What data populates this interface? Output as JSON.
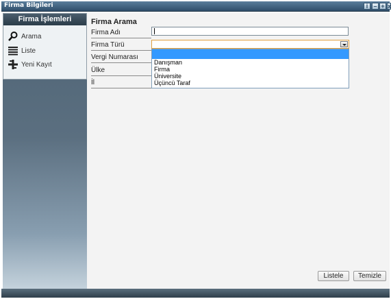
{
  "window": {
    "title": "Firma Bilgileri"
  },
  "sidebar": {
    "header": "Firma İşlemleri",
    "items": [
      {
        "label": "Arama",
        "icon": "search-icon"
      },
      {
        "label": "Liste",
        "icon": "list-icon"
      },
      {
        "label": "Yeni Kayıt",
        "icon": "new-record-icon"
      }
    ]
  },
  "main": {
    "title": "Firma Arama",
    "fields": {
      "firma_adi": {
        "label": "Firma Adı",
        "value": ""
      },
      "firma_turu": {
        "label": "Firma Türü",
        "value": ""
      },
      "vergi_numarasi": {
        "label": "Vergi Numarası"
      },
      "ulke": {
        "label": "Ülke"
      },
      "il": {
        "label": "İl"
      }
    },
    "firma_turu_options": [
      "",
      "Danışman",
      "Firma",
      "Üniversite",
      "Üçüncü Taraf"
    ],
    "buttons": {
      "list": "Listele",
      "clear": "Temizle"
    }
  },
  "colors": {
    "accent": "#3399ff",
    "focus_border": "#e0a040",
    "sidebar_dark": "#4e6475"
  }
}
